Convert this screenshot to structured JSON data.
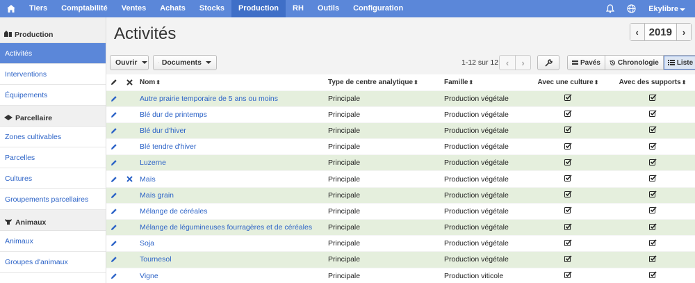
{
  "topbar": {
    "home_icon": "home-icon",
    "items": [
      {
        "label": "Tiers"
      },
      {
        "label": "Comptabilité"
      },
      {
        "label": "Ventes"
      },
      {
        "label": "Achats"
      },
      {
        "label": "Stocks"
      },
      {
        "label": "Production",
        "active": true
      },
      {
        "label": "RH"
      },
      {
        "label": "Outils"
      },
      {
        "label": "Configuration"
      }
    ],
    "user": "Ekylibre",
    "bell_icon": "bell-icon",
    "globe_icon": "globe-icon"
  },
  "sidebar": {
    "groups": [
      {
        "title": "Production",
        "icon": "farm-icon",
        "items": [
          "Activités",
          "Interventions",
          "Équipements"
        ]
      },
      {
        "title": "Parcellaire",
        "icon": "land-icon",
        "items": [
          "Zones cultivables",
          "Parcelles",
          "Cultures",
          "Groupements parcellaires"
        ]
      },
      {
        "title": "Animaux",
        "icon": "cow-icon",
        "items": [
          "Animaux",
          "Groupes d'animaux"
        ]
      }
    ],
    "active": "Activités"
  },
  "page": {
    "title": "Activités",
    "year": "2019",
    "prev": "‹",
    "next": "›"
  },
  "toolbar": {
    "open_label": "Ouvrir",
    "documents_label": "Documents",
    "pager_text": "1-12 sur 12",
    "view_tiles": "Pavés",
    "view_timeline": "Chronologie",
    "view_list": "Liste"
  },
  "table": {
    "headers": {
      "name": "Nom",
      "cost_center": "Type de centre analytique",
      "family": "Famille",
      "with_crop": "Avec une culture",
      "with_support": "Avec des supports"
    },
    "rows": [
      {
        "name": "Autre prairie temporaire de 5 ans ou moins",
        "cost_center": "Principale",
        "family": "Production végétale",
        "crop": true,
        "support": true,
        "deletable": false
      },
      {
        "name": "Blé dur de printemps",
        "cost_center": "Principale",
        "family": "Production végétale",
        "crop": true,
        "support": true,
        "deletable": false
      },
      {
        "name": "Blé dur d'hiver",
        "cost_center": "Principale",
        "family": "Production végétale",
        "crop": true,
        "support": true,
        "deletable": false
      },
      {
        "name": "Blé tendre d'hiver",
        "cost_center": "Principale",
        "family": "Production végétale",
        "crop": true,
        "support": true,
        "deletable": false
      },
      {
        "name": "Luzerne",
        "cost_center": "Principale",
        "family": "Production végétale",
        "crop": true,
        "support": true,
        "deletable": false
      },
      {
        "name": "Maïs",
        "cost_center": "Principale",
        "family": "Production végétale",
        "crop": true,
        "support": true,
        "deletable": true
      },
      {
        "name": "Maïs grain",
        "cost_center": "Principale",
        "family": "Production végétale",
        "crop": true,
        "support": true,
        "deletable": false
      },
      {
        "name": "Mélange de céréales",
        "cost_center": "Principale",
        "family": "Production végétale",
        "crop": true,
        "support": true,
        "deletable": false
      },
      {
        "name": "Mélange de légumineuses fourragères et de céréales",
        "cost_center": "Principale",
        "family": "Production végétale",
        "crop": true,
        "support": true,
        "deletable": false
      },
      {
        "name": "Soja",
        "cost_center": "Principale",
        "family": "Production végétale",
        "crop": true,
        "support": true,
        "deletable": false
      },
      {
        "name": "Tournesol",
        "cost_center": "Principale",
        "family": "Production végétale",
        "crop": true,
        "support": true,
        "deletable": false
      },
      {
        "name": "Vigne",
        "cost_center": "Principale",
        "family": "Production viticole",
        "crop": true,
        "support": true,
        "deletable": false
      }
    ]
  },
  "colors": {
    "accent": "#5b87d9",
    "row_alt": "#e5efdd",
    "link": "#2c63c7"
  }
}
